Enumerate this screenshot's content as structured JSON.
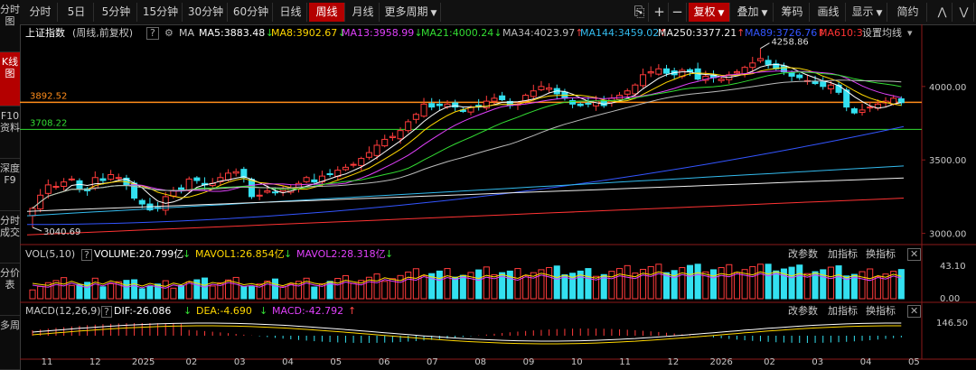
{
  "sidebar": {
    "items": [
      {
        "label": "分时图",
        "active": false
      },
      {
        "label": "K线图",
        "active": true
      },
      {
        "label": "F10资料",
        "active": false
      },
      {
        "label": "深度F9",
        "active": false
      },
      {
        "label": "分时成交",
        "active": false
      },
      {
        "label": "分价表",
        "active": false
      },
      {
        "label": "多周",
        "active": false
      }
    ]
  },
  "toolbar": {
    "periods": [
      "分时",
      "5日",
      "5分钟",
      "15分钟",
      "30分钟",
      "60分钟",
      "日线",
      "周线",
      "月线",
      "更多周期"
    ],
    "active_period": "周线",
    "right_buttons": [
      "复权",
      "叠加",
      "筹码",
      "画线",
      "显示",
      "简约"
    ],
    "icons": [
      "lock-icon",
      "plus-icon",
      "minus-icon",
      "collapse-icon"
    ]
  },
  "info": {
    "title": "上证指数",
    "subtitle": "(周线,前复权)",
    "help": "?",
    "ma_label": "MA",
    "mas": [
      {
        "text": "MA5:3883.48",
        "color": "#ffffff",
        "arrow": "↓"
      },
      {
        "text": "MA8:3902.67",
        "color": "#ffd700",
        "arrow": "↓"
      },
      {
        "text": "MA13:3958.99",
        "color": "#e040fb",
        "arrow": "↓"
      },
      {
        "text": "MA21:4000.24",
        "color": "#33dd33",
        "arrow": "↓"
      },
      {
        "text": "MA34:4023.97",
        "color": "#bbbbbb",
        "arrow": "↑"
      },
      {
        "text": "MA144:3459.02",
        "color": "#33bbee",
        "arrow": "↑"
      },
      {
        "text": "MA250:3377.21",
        "color": "#eeeeee",
        "arrow": "↑"
      },
      {
        "text": "MA89:3726.76",
        "color": "#3355ff",
        "arrow": "↑"
      },
      {
        "text": "MA610:3",
        "color": "#ff3333",
        "arrow": ""
      }
    ],
    "settings": "设置均线"
  },
  "price_axis": {
    "labels": [
      "4000.00",
      "3500.00",
      "3000.00"
    ],
    "left_labels": [
      {
        "text": "3892.52",
        "color": "#ff8c1a"
      },
      {
        "text": "3708.22",
        "color": "#33dd33"
      }
    ]
  },
  "annotations": {
    "high": "4258.86",
    "low": "3040.69"
  },
  "volume": {
    "title": "VOL(5,10)",
    "items": [
      {
        "text": "VOLUME:20.799亿",
        "color": "#ffffff",
        "arrow": "↓"
      },
      {
        "text": "MAVOL1:26.854亿",
        "color": "#ffd700",
        "arrow": "↓"
      },
      {
        "text": "MAVOL2:28.318亿",
        "color": "#e040fb",
        "arrow": "↓"
      }
    ],
    "axis": [
      "43.10",
      "0.00"
    ],
    "buttons": [
      "改参数",
      "加指标",
      "换指标"
    ]
  },
  "macd": {
    "title": "MACD(12,26,9)",
    "items": [
      {
        "text": "DIF:-26.086",
        "color": "#ffffff",
        "arrow": "↓"
      },
      {
        "text": "DEA:-4.690",
        "color": "#ffd700",
        "arrow": "↓"
      },
      {
        "text": "MACD:-42.792",
        "color": "#e040fb",
        "arrow": "↑"
      }
    ],
    "axis": [
      "146.50"
    ],
    "buttons": [
      "改参数",
      "加指标",
      "换指标"
    ]
  },
  "time_axis": [
    "11",
    "12",
    "2025",
    "02",
    "03",
    "04",
    "05",
    "06",
    "07",
    "08",
    "09",
    "10",
    "11",
    "12",
    "2026",
    "02",
    "03",
    "04",
    "05"
  ],
  "chart_data": {
    "type": "candlestick",
    "title": "上证指数",
    "period": "周线",
    "high": 4258.86,
    "low": 3040.69,
    "ylim": [
      2930,
      4300
    ],
    "ref_lines": [
      3892.52,
      3708.22
    ],
    "ma_values": {
      "MA5": 3883.48,
      "MA8": 3902.67,
      "MA13": 3958.99,
      "MA21": 4000.24,
      "MA34": 4023.97,
      "MA144": 3459.02,
      "MA250": 3377.21,
      "MA89": 3726.76
    },
    "closes": [
      3170,
      3260,
      3330,
      3320,
      3350,
      3370,
      3300,
      3290,
      3380,
      3360,
      3400,
      3380,
      3330,
      3240,
      3200,
      3160,
      3170,
      3250,
      3290,
      3300,
      3370,
      3360,
      3330,
      3340,
      3380,
      3410,
      3420,
      3380,
      3250,
      3260,
      3290,
      3280,
      3300,
      3310,
      3340,
      3380,
      3350,
      3390,
      3400,
      3430,
      3450,
      3470,
      3510,
      3550,
      3600,
      3640,
      3660,
      3700,
      3760,
      3810,
      3880,
      3860,
      3870,
      3880,
      3860,
      3830,
      3860,
      3870,
      3900,
      3920,
      3910,
      3870,
      3880,
      3940,
      3970,
      4000,
      3990,
      3950,
      3920,
      3880,
      3870,
      3880,
      3900,
      3870,
      3920,
      3940,
      3970,
      4010,
      4080,
      4100,
      4120,
      4090,
      4080,
      4110,
      4100,
      4050,
      4070,
      4060,
      4050,
      4080,
      4100,
      4130,
      4160,
      4190,
      4150,
      4120,
      4100,
      4070,
      4060,
      4040,
      4020,
      4000,
      4010,
      3960,
      3860,
      3820,
      3840,
      3860,
      3880,
      3900,
      3920,
      3890
    ]
  }
}
